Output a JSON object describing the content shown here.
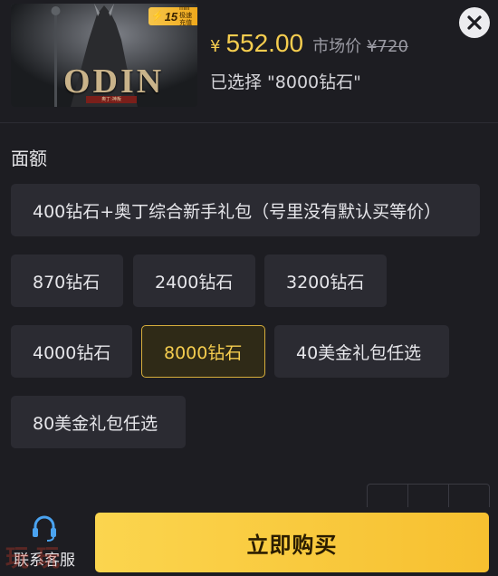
{
  "product": {
    "badge_number": "15",
    "badge_unit": "min",
    "badge_text": "极速充值",
    "logo_text": "ODIN",
    "logo_sub": "奥丁:神叛",
    "currency_symbol": "¥",
    "price": "552.00",
    "market_label": "市场价",
    "market_price": "¥720",
    "selected_text": "已选择 \"8000钻石\""
  },
  "section": {
    "title": "面额"
  },
  "options": [
    {
      "label": "400钻石+奥丁综合新手礼包（号里没有默认买等价）",
      "active": false
    },
    {
      "label": "870钻石",
      "active": false
    },
    {
      "label": "2400钻石",
      "active": false
    },
    {
      "label": "3200钻石",
      "active": false
    },
    {
      "label": "4000钻石",
      "active": false
    },
    {
      "label": "8000钻石",
      "active": true
    },
    {
      "label": "40美金礼包任选",
      "active": false
    },
    {
      "label": "80美金礼包任选",
      "active": false
    }
  ],
  "footer": {
    "service_label": "联系客服",
    "buy_label": "立即购买",
    "watermark": "玩玩"
  },
  "colors": {
    "accent": "#f5cd4f",
    "background": "#1d1d22",
    "option_bg": "#2b2b32"
  },
  "icons": {
    "close": "close-icon",
    "service": "headset-icon"
  }
}
